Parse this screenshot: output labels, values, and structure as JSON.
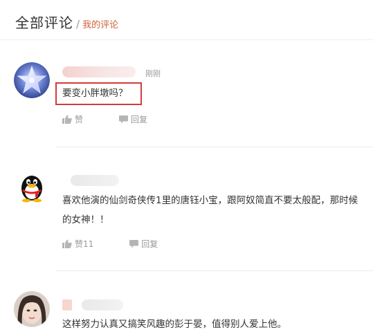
{
  "header": {
    "title": "全部评论",
    "separator": "/",
    "breadcrumb": "我的评论"
  },
  "comments": [
    {
      "time": "刚刚",
      "text": "要变小胖墩吗？",
      "like_label": "赞",
      "reply_label": "回复"
    },
    {
      "text": "喜欢他演的仙剑奇侠传1里的唐钰小宝，跟阿奴简直不要太般配，那时候的女神！！",
      "like_label": "赞11",
      "reply_label": "回复"
    },
    {
      "text": "这样努力认真又搞笑风趣的彭于晏，值得别人爱上他。"
    }
  ],
  "colors": {
    "accent": "#d1603b",
    "highlight": "#d33a3a"
  }
}
